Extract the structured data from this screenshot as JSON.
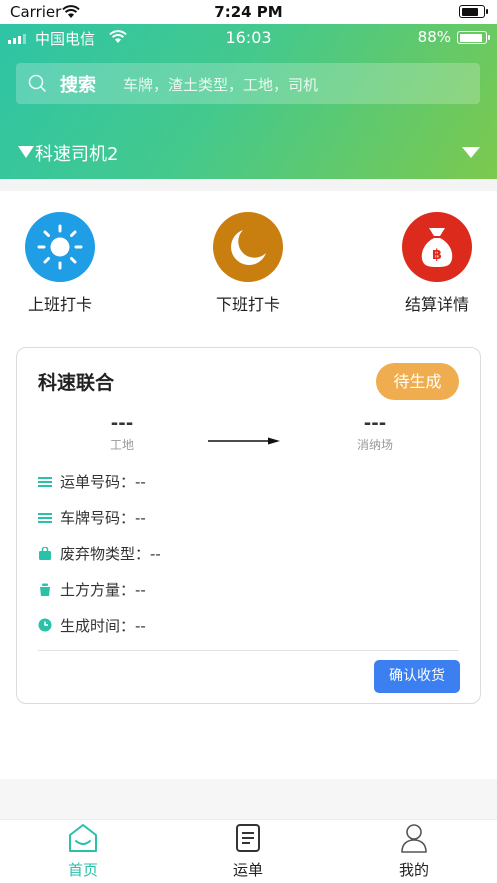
{
  "device_status": {
    "carrier": "Carrier",
    "time": "7:24 PM"
  },
  "app_status": {
    "carrier": "中国电信",
    "time": "16:03",
    "battery": "88%"
  },
  "search": {
    "label": "搜索",
    "placeholder": "车牌，渣土类型，工地，司机"
  },
  "driver_selector": {
    "label": "科速司机2"
  },
  "actions": [
    {
      "label": "上班打卡",
      "icon": "sun-icon",
      "color": "#1f9ee6"
    },
    {
      "label": "下班打卡",
      "icon": "moon-icon",
      "color": "#c97f10"
    },
    {
      "label": "结算详情",
      "icon": "money-bag-icon",
      "color": "#dc2b1c"
    }
  ],
  "order_card": {
    "company": "科速联合",
    "status": "待生成",
    "from_value": "---",
    "from_label": "工地",
    "to_value": "---",
    "to_label": "消纳场",
    "fields": [
      {
        "label": "运单号码：--",
        "icon": "list-icon"
      },
      {
        "label": "车牌号码：--",
        "icon": "list-icon"
      },
      {
        "label": "废弃物类型：--",
        "icon": "bag-icon"
      },
      {
        "label": "土方方量：--",
        "icon": "bucket-icon"
      },
      {
        "label": "生成时间：--",
        "icon": "clock-icon"
      }
    ],
    "confirm_button": "确认收货"
  },
  "tabs": [
    {
      "label": "首页",
      "icon": "home-icon",
      "active": true
    },
    {
      "label": "运单",
      "icon": "document-icon",
      "active": false
    },
    {
      "label": "我的",
      "icon": "user-icon",
      "active": false
    }
  ],
  "colors": {
    "accent_green": "#2ec4a6",
    "active_tab": "#29c1a8",
    "badge": "#f0ad50",
    "primary_button": "#3b7ff1"
  }
}
